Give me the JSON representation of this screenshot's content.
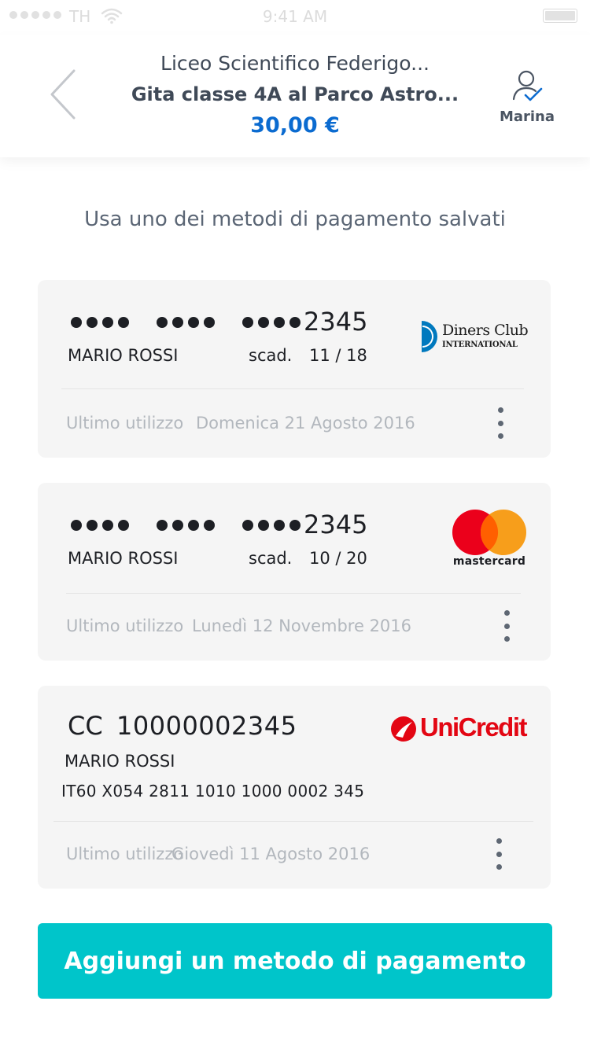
{
  "status_bar": {
    "carrier": "TH",
    "time": "9:41 AM"
  },
  "header": {
    "school": "Liceo Scientifico Federigo...",
    "trip": "Gita classe 4A al Parco Astro...",
    "amount": "30,00 €",
    "user_name": "Marina"
  },
  "section_title": "Usa uno dei metodi di pagamento salvati",
  "cards": [
    {
      "brand": "Diners Club International",
      "brand_text_1": "Diners Club",
      "brand_text_2": "INTERNATIONAL",
      "last4": "2345",
      "holder": "MARIO ROSSI",
      "expiry_label": "scad.",
      "expiry": "11 / 18",
      "last_used_label": "Ultimo utilizzo",
      "last_used_date": "Domenica 21 Agosto 2016"
    },
    {
      "brand": "mastercard",
      "brand_text": "mastercard",
      "last4": "2345",
      "holder": "MARIO ROSSI",
      "expiry_label": "scad.",
      "expiry": "10 / 20",
      "last_used_label": "Ultimo utilizzo",
      "last_used_date": "Lunedì 12 Novembre 2016"
    }
  ],
  "bank_account": {
    "brand": "UniCredit",
    "prefix": "CC",
    "number": "10000002345",
    "holder": "MARIO ROSSI",
    "iban": "IT60 X054 2811 1010 1000 0002 345",
    "last_used_label": "Ultimo utilizzo",
    "last_used_date": "Giovedì 11 Agosto 2016"
  },
  "add_button_label": "Aggiungi un metodo di pagamento",
  "colors": {
    "accent": "#00c5ca",
    "amount": "#0b6bd0",
    "card_bg": "#f5f5f5",
    "unicredit_red": "#e30613",
    "diners_blue": "#0079be",
    "mc_red": "#eb001b",
    "mc_orange": "#f79e1b"
  }
}
